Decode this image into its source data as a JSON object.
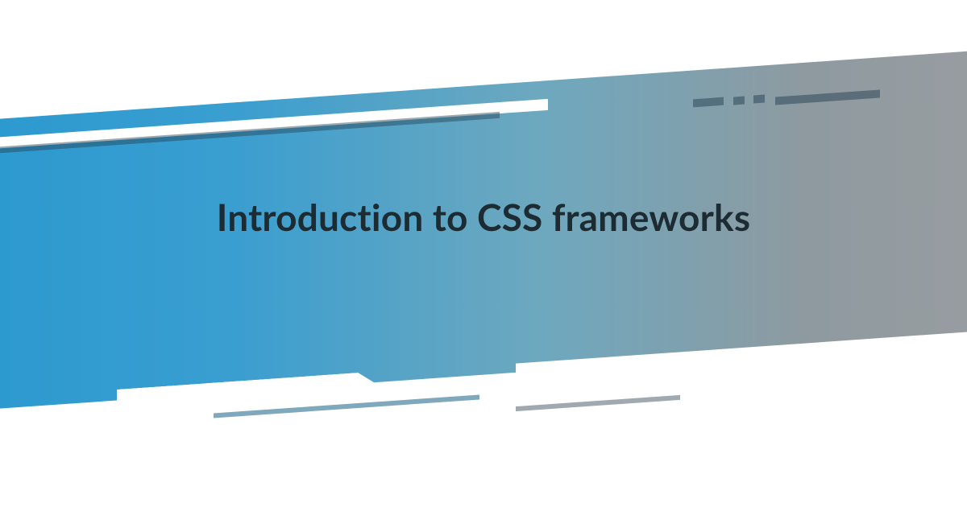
{
  "hero": {
    "title": "Introduction to CSS frameworks"
  },
  "colors": {
    "gradient_start": "#2b99cf",
    "gradient_end": "#9a9da1",
    "title_color": "#1d2b33"
  }
}
